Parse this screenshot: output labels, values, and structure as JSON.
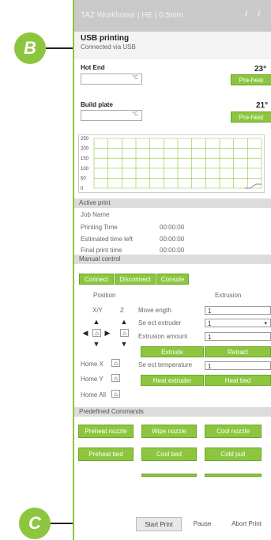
{
  "title_bar": {
    "title": "TAZ Workhorse | HE | 0.5mm"
  },
  "status": {
    "heading": "USB printing",
    "subtext": "Connected via USB"
  },
  "hot_end": {
    "label": "Hot End",
    "temp": "23°",
    "unit": "°C",
    "preheat": "Pre-heat"
  },
  "build_plate": {
    "label": "Build plate",
    "temp": "21°",
    "unit": "°C",
    "preheat": "Pre-heat"
  },
  "chart_data": {
    "type": "line",
    "yticks": [
      "250",
      "200",
      "150",
      "100",
      "50",
      "0"
    ],
    "ylim": [
      0,
      250
    ],
    "series": [
      {
        "values": [
          0,
          0,
          20,
          20
        ]
      }
    ]
  },
  "active_print": {
    "heading": "Active print",
    "job_name_label": "Job Name",
    "rows": [
      {
        "label": "Printing Time",
        "value": "00:00:00"
      },
      {
        "label": "Estimated time left",
        "value": "00:00:00"
      },
      {
        "label": "Final print time",
        "value": "00:00:00"
      }
    ]
  },
  "manual": {
    "heading": "Manual control",
    "connect": "Connect",
    "disconnect": "Disconnect",
    "console": "Console",
    "position_label": "Position",
    "extrusion_label": "Extrusion",
    "xy_label": "X/Y",
    "z_label": "Z",
    "move_length_label": "Move ength",
    "move_length_value": "1",
    "select_extruder_label": "Se ect extruder",
    "select_extruder_value": "1",
    "extrusion_amount_label": "Extrusion amount",
    "extrusion_amount_value": "1",
    "extrude": "Extrude",
    "retract": "Retract",
    "select_temp_label": "Se ect temperature",
    "select_temp_value": "1",
    "heat_extruder": "Heat extruder",
    "heat_bed": "Heat bed",
    "home_x": "Home X",
    "home_y": "Home Y",
    "home_all": "Home All"
  },
  "predefined": {
    "heading": "Predefined Commands",
    "buttons": [
      "Preheat nozzle",
      "Wipe nozzle",
      "Cool nozzle",
      "Preheat bed",
      "Cool bed",
      "Cold pull"
    ]
  },
  "controls": {
    "start": "Start Print",
    "pause": "Pause",
    "abort": "Abort Print"
  },
  "callouts": {
    "b": "B",
    "c": "C"
  },
  "colors": {
    "accent": "#8cc63f"
  }
}
